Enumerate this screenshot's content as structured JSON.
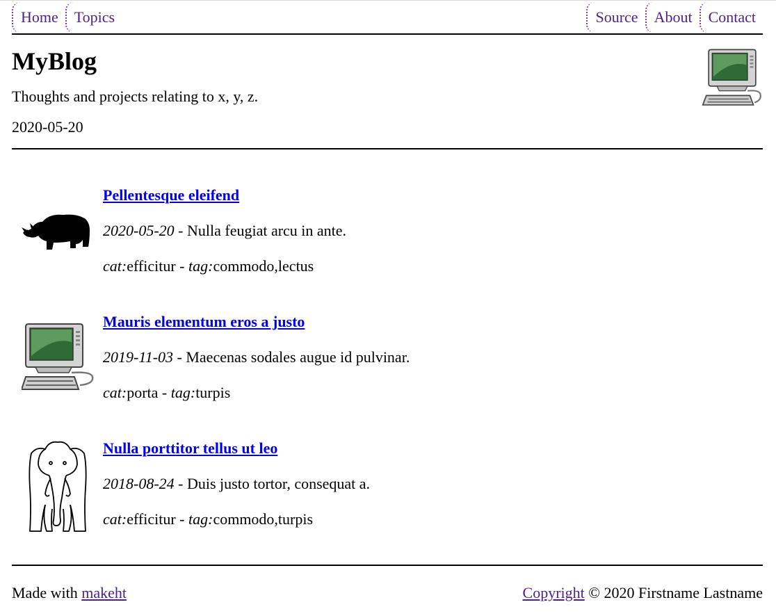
{
  "nav": {
    "left": [
      {
        "label": "Home"
      },
      {
        "label": "Topics"
      }
    ],
    "right": [
      {
        "label": "Source"
      },
      {
        "label": "About"
      },
      {
        "label": "Contact"
      }
    ]
  },
  "header": {
    "title": "MyBlog",
    "tagline": "Thoughts and projects relating to x, y, z.",
    "date": "2020-05-20",
    "icon": "computer-icon"
  },
  "posts": [
    {
      "title": "Pellentesque eleifend",
      "date": "2020-05-20",
      "separator": " - ",
      "summary": "Nulla feugiat arcu in ante.",
      "cat_label": "cat:",
      "cat": "efficitur",
      "tag_label": "tag:",
      "tags": "commodo,lectus",
      "icon": "rhinoceros-icon"
    },
    {
      "title": "Mauris elementum eros a justo",
      "date": "2019-11-03",
      "separator": " - ",
      "summary": "Maecenas sodales augue id pulvinar.",
      "cat_label": "cat:",
      "cat": "porta",
      "tag_label": "tag:",
      "tags": "turpis",
      "icon": "computer-icon"
    },
    {
      "title": "Nulla porttitor tellus ut leo",
      "date": "2018-08-24",
      "separator": " - ",
      "summary": "Duis justo tortor, consequat a.",
      "cat_label": "cat:",
      "cat": "efficitur",
      "tag_label": "tag:",
      "tags": "commodo,turpis",
      "icon": "elephant-icon"
    }
  ],
  "footer": {
    "made_with": "Made with ",
    "makeht_link": "makeht",
    "copyright_link": "Copyright",
    "copyright_text": " © 2020 Firstname Lastname"
  },
  "colors": {
    "nav_link": "#4e1f8a",
    "post_link": "#0000ee",
    "rule": "#000000"
  }
}
